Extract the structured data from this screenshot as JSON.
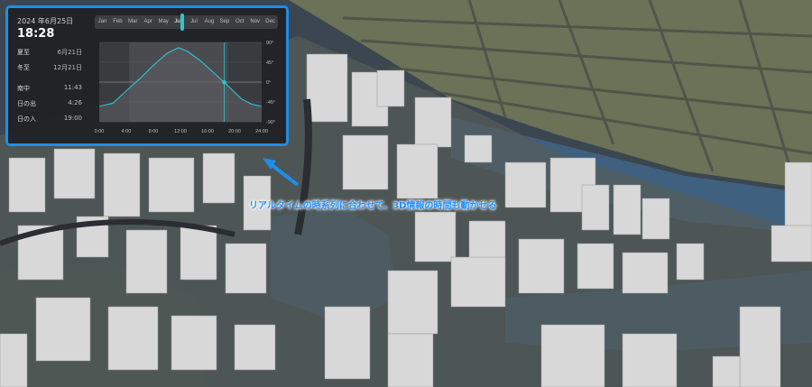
{
  "panel": {
    "date": "2024 年6月25日",
    "time": "18:28",
    "months": [
      "Jan",
      "Feb",
      "Mar",
      "Apr",
      "May",
      "Jun",
      "Jul",
      "Aug",
      "Sep",
      "Oct",
      "Nov",
      "Dec"
    ],
    "selected_month": "Jun",
    "stats": [
      {
        "label": "夏至",
        "value": "6月21日"
      },
      {
        "label": "冬至",
        "value": "12月21日"
      },
      {
        "label": "南中",
        "value": "11:43"
      },
      {
        "label": "日の出",
        "value": "4:26"
      },
      {
        "label": "日の入",
        "value": "19:00"
      }
    ]
  },
  "chart_data": {
    "type": "line",
    "x_ticks": [
      "0:00",
      "4:00",
      "8:00",
      "12:00",
      "16:00",
      "20:00",
      "24:00"
    ],
    "y_ticks": [
      "90°",
      "45°",
      "0°",
      "-45°",
      "-90°"
    ],
    "xlim": [
      0,
      24
    ],
    "ylim": [
      -90,
      90
    ],
    "current_time": 18.47,
    "series": [
      {
        "x": [
          0,
          2,
          4,
          6,
          8,
          10,
          11.7,
          13,
          15,
          17,
          19,
          21,
          22.5,
          24
        ],
        "values": [
          -55,
          -48,
          -20,
          8,
          38,
          65,
          78,
          70,
          48,
          20,
          -8,
          -38,
          -50,
          -55
        ]
      }
    ]
  },
  "callout": {
    "text": "リアルタイムの時系列に合わせて、3D情報の時間も動かせる"
  },
  "colors": {
    "accent": "#1f8ee6",
    "curve": "#2ec5cf",
    "water": "#3a5a78",
    "land": "#66705c"
  }
}
